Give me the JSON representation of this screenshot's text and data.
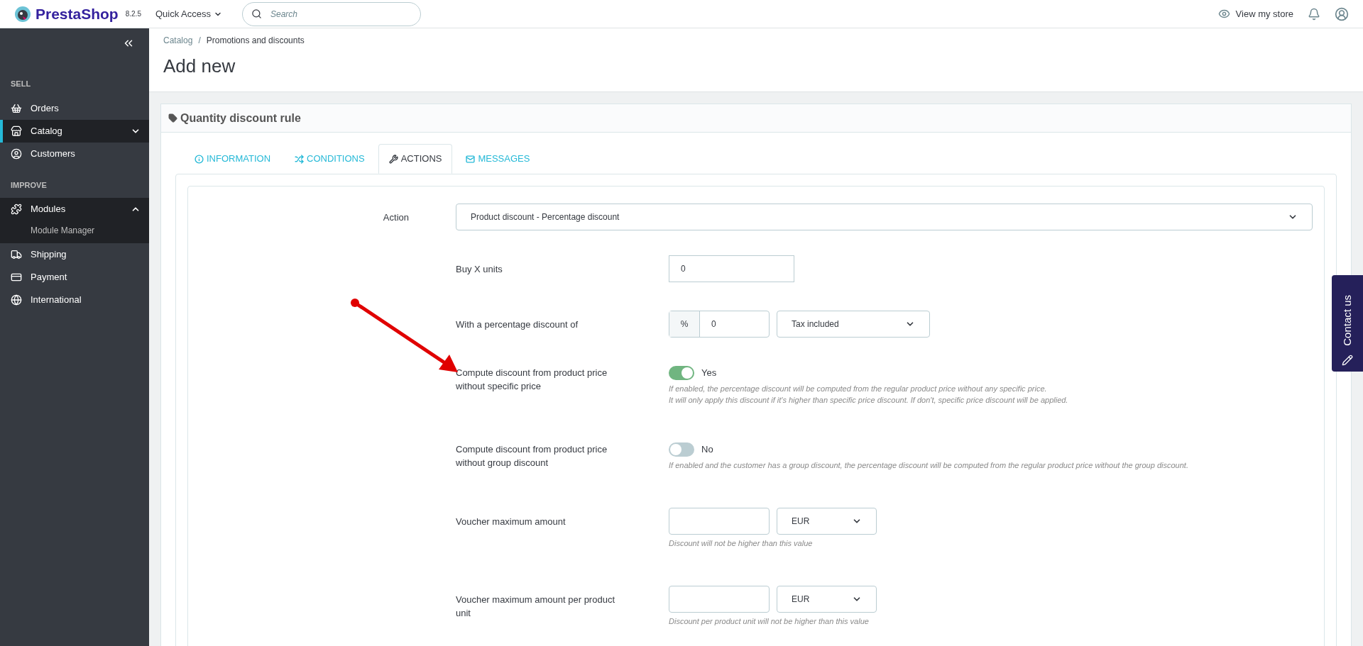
{
  "header": {
    "logo": "PrestaShop",
    "version": "8.2.5",
    "quick_access": "Quick Access",
    "search": {
      "placeholder": "Search"
    },
    "view_store": "View my store"
  },
  "sidebar": {
    "sections": [
      {
        "title": "SELL",
        "items": [
          {
            "label": "Orders",
            "selected": false
          },
          {
            "label": "Catalog",
            "selected": true,
            "expanded": false
          },
          {
            "label": "Customers",
            "selected": false
          }
        ]
      },
      {
        "title": "IMPROVE",
        "items": [
          {
            "label": "Modules",
            "selected": false,
            "expanded": true,
            "children": [
              {
                "label": "Module Manager",
                "selected": false
              }
            ]
          },
          {
            "label": "Shipping",
            "selected": false
          },
          {
            "label": "Payment",
            "selected": false
          },
          {
            "label": "International",
            "selected": false
          }
        ]
      }
    ]
  },
  "breadcrumb": {
    "items": [
      "Catalog",
      "Promotions and discounts"
    ],
    "separator": "/"
  },
  "page_title": "Add new",
  "card": {
    "title": "Quantity discount rule",
    "tabs": [
      {
        "label": "INFORMATION",
        "selected": false
      },
      {
        "label": "CONDITIONS",
        "selected": false
      },
      {
        "label": "ACTIONS",
        "selected": true
      },
      {
        "label": "MESSAGES",
        "selected": false
      }
    ],
    "action": {
      "label": "Action",
      "value": "Product discount - Percentage discount"
    },
    "fields": [
      {
        "kind": "input",
        "label": "Buy X units",
        "value": "0"
      },
      {
        "kind": "percent",
        "label": "With a percentage discount of",
        "addon": "%",
        "value": "0",
        "select": "Tax included"
      },
      {
        "kind": "toggle",
        "label": "Compute discount from product price without specific price",
        "on": true,
        "state_label": "Yes",
        "help": [
          "If enabled, the percentage discount will be computed from the regular product price without any specific price.",
          "It will only apply this discount if it's higher than specific price discount. If don't, specific price discount will be applied."
        ]
      },
      {
        "kind": "toggle",
        "label": "Compute discount from product price without group discount",
        "on": false,
        "state_label": "No",
        "help": [
          "If enabled and the customer has a group discount, the percentage discount will be computed from the regular product price without the group discount."
        ]
      },
      {
        "kind": "amount",
        "label": "Voucher maximum amount",
        "select": "EUR",
        "help": [
          "Discount will not be higher than this value"
        ]
      },
      {
        "kind": "amount",
        "label": "Voucher maximum amount per product unit",
        "select": "EUR",
        "help": [
          "Discount per product unit will not be higher than this value"
        ]
      }
    ]
  },
  "contact_tab": "Contact us"
}
